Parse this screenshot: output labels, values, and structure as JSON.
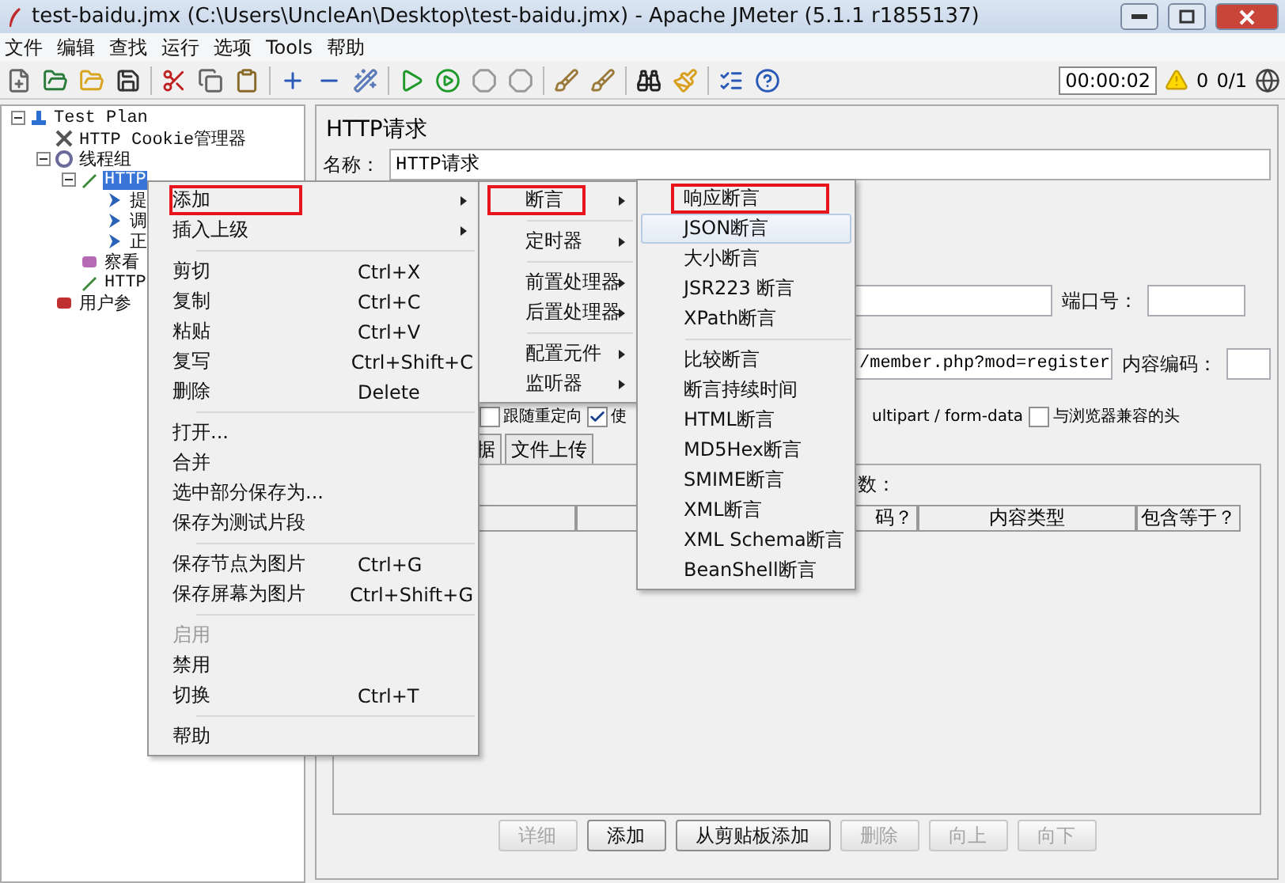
{
  "window": {
    "title": "test-baidu.jmx (C:\\Users\\UncleAn\\Desktop\\test-baidu.jmx) - Apache JMeter (5.1.1 r1855137)"
  },
  "menu_bar": [
    "文件",
    "编辑",
    "查找",
    "运行",
    "选项",
    "Tools",
    "帮助"
  ],
  "toolbar": {
    "timer": "00:00:02",
    "warnings": "0",
    "threads": "0/1"
  },
  "tree": [
    {
      "label": "Test Plan",
      "kind": "plan",
      "selected": false,
      "children": [
        {
          "label": "HTTP Cookie管理器",
          "kind": "config",
          "selected": false
        },
        {
          "label": "线程组",
          "kind": "threads",
          "selected": false,
          "children": [
            {
              "label": "HTTP",
              "kind": "sampler",
              "selected": true,
              "children": [
                {
                  "label": "提",
                  "kind": "controller",
                  "selected": false
                },
                {
                  "label": "调",
                  "kind": "controller",
                  "selected": false
                },
                {
                  "label": "正",
                  "kind": "controller",
                  "selected": false
                }
              ]
            },
            {
              "label": "察看",
              "kind": "listener",
              "selected": false
            },
            {
              "label": "HTTP",
              "kind": "sampler",
              "selected": false
            }
          ]
        },
        {
          "label": "用户参",
          "kind": "preprocessor",
          "selected": false
        }
      ]
    }
  ],
  "panel": {
    "title": "HTTP请求",
    "name_label": "名称：",
    "name_value": "HTTP请求",
    "port_label": "端口号：",
    "path_value": "/member.php?mod=register",
    "encoding_label": "内容编码：",
    "options": [
      {
        "label": "跟随重定向",
        "checked": false
      },
      {
        "label": "使",
        "checked": true
      }
    ],
    "multipart_text": "ultipart / form-data",
    "browser_option": {
      "label": "与浏览器兼容的头",
      "checked": false
    },
    "tabs": [
      {
        "label": "据",
        "selected": false
      },
      {
        "label": "文件上传",
        "selected": false
      }
    ],
    "params_label": "数：",
    "columns": [
      "码？",
      "内容类型",
      "包含等于？"
    ],
    "buttons": [
      {
        "label": "详细",
        "disabled": true
      },
      {
        "label": "添加",
        "disabled": false
      },
      {
        "label": "从剪贴板添加",
        "disabled": false
      },
      {
        "label": "删除",
        "disabled": true
      },
      {
        "label": "向上",
        "disabled": true
      },
      {
        "label": "向下",
        "disabled": true
      }
    ]
  },
  "context_menu": [
    {
      "kind": "item",
      "label": "添加",
      "arrow": true,
      "annotated": true,
      "disabled": false
    },
    {
      "kind": "item",
      "label": "插入上级",
      "arrow": true,
      "annotated": false,
      "disabled": false
    },
    {
      "kind": "separator"
    },
    {
      "kind": "item",
      "label": "剪切",
      "shortcut": "Ctrl+X",
      "arrow": false,
      "annotated": false,
      "disabled": false
    },
    {
      "kind": "item",
      "label": "复制",
      "shortcut": "Ctrl+C",
      "arrow": false,
      "annotated": false,
      "disabled": false
    },
    {
      "kind": "item",
      "label": "粘贴",
      "shortcut": "Ctrl+V",
      "arrow": false,
      "annotated": false,
      "disabled": false
    },
    {
      "kind": "item",
      "label": "复写",
      "shortcut": "Ctrl+Shift+C",
      "arrow": false,
      "annotated": false,
      "disabled": false
    },
    {
      "kind": "item",
      "label": "删除",
      "shortcut": "Delete",
      "arrow": false,
      "annotated": false,
      "disabled": false
    },
    {
      "kind": "separator"
    },
    {
      "kind": "item",
      "label": "打开...",
      "arrow": false,
      "annotated": false,
      "disabled": false
    },
    {
      "kind": "item",
      "label": "合并",
      "arrow": false,
      "annotated": false,
      "disabled": false
    },
    {
      "kind": "item",
      "label": "选中部分保存为...",
      "arrow": false,
      "annotated": false,
      "disabled": false
    },
    {
      "kind": "item",
      "label": "保存为测试片段",
      "arrow": false,
      "annotated": false,
      "disabled": false
    },
    {
      "kind": "separator"
    },
    {
      "kind": "item",
      "label": "保存节点为图片",
      "shortcut": "Ctrl+G",
      "arrow": false,
      "annotated": false,
      "disabled": false
    },
    {
      "kind": "item",
      "label": "保存屏幕为图片",
      "shortcut": "Ctrl+Shift+G",
      "arrow": false,
      "annotated": false,
      "disabled": false
    },
    {
      "kind": "separator"
    },
    {
      "kind": "item",
      "label": "启用",
      "arrow": false,
      "annotated": false,
      "disabled": true
    },
    {
      "kind": "item",
      "label": "禁用",
      "arrow": false,
      "annotated": false,
      "disabled": false
    },
    {
      "kind": "item",
      "label": "切换",
      "shortcut": "Ctrl+T",
      "arrow": false,
      "annotated": false,
      "disabled": false
    },
    {
      "kind": "separator"
    },
    {
      "kind": "item",
      "label": "帮助",
      "arrow": false,
      "annotated": false,
      "disabled": false
    }
  ],
  "add_menu": [
    {
      "kind": "item",
      "label": "断言",
      "annotated": true
    },
    {
      "kind": "separator"
    },
    {
      "kind": "item",
      "label": "定时器",
      "annotated": false
    },
    {
      "kind": "separator"
    },
    {
      "kind": "item",
      "label": "前置处理器",
      "annotated": false
    },
    {
      "kind": "item",
      "label": "后置处理器",
      "annotated": false
    },
    {
      "kind": "separator"
    },
    {
      "kind": "item",
      "label": "配置元件",
      "annotated": false
    },
    {
      "kind": "item",
      "label": "监听器",
      "annotated": false
    }
  ],
  "assertion_menu": [
    {
      "kind": "item",
      "label": "响应断言",
      "annotated": true,
      "hovered": false
    },
    {
      "kind": "item",
      "label": "JSON断言",
      "annotated": false,
      "hovered": true
    },
    {
      "kind": "item",
      "label": "大小断言",
      "annotated": false,
      "hovered": false
    },
    {
      "kind": "item",
      "label": "JSR223 断言",
      "annotated": false,
      "hovered": false
    },
    {
      "kind": "item",
      "label": "XPath断言",
      "annotated": false,
      "hovered": false
    },
    {
      "kind": "separator"
    },
    {
      "kind": "item",
      "label": "比较断言",
      "annotated": false,
      "hovered": false
    },
    {
      "kind": "item",
      "label": "断言持续时间",
      "annotated": false,
      "hovered": false
    },
    {
      "kind": "item",
      "label": "HTML断言",
      "annotated": false,
      "hovered": false
    },
    {
      "kind": "item",
      "label": "MD5Hex断言",
      "annotated": false,
      "hovered": false
    },
    {
      "kind": "item",
      "label": "SMIME断言",
      "annotated": false,
      "hovered": false
    },
    {
      "kind": "item",
      "label": "XML断言",
      "annotated": false,
      "hovered": false
    },
    {
      "kind": "item",
      "label": "XML Schema断言",
      "annotated": false,
      "hovered": false
    },
    {
      "kind": "item",
      "label": "BeanShell断言",
      "annotated": false,
      "hovered": false
    }
  ]
}
